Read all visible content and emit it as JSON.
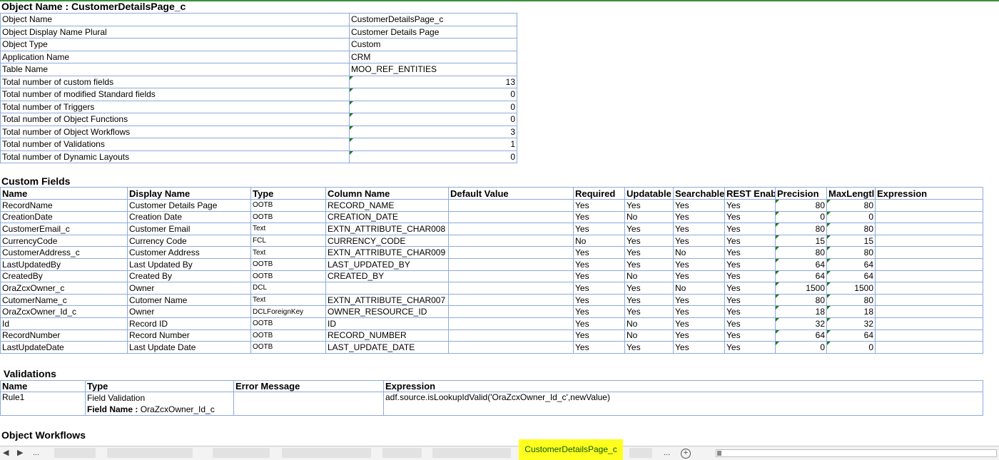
{
  "title": "Object Name : CustomerDetailsPage_c",
  "summary": [
    {
      "label": "Object Name",
      "value": "CustomerDetailsPage_c",
      "numeric": false
    },
    {
      "label": "Object Display Name Plural",
      "value": "Customer Details Page",
      "numeric": false
    },
    {
      "label": "Object Type",
      "value": "Custom",
      "numeric": false
    },
    {
      "label": "Application Name",
      "value": "CRM",
      "numeric": false
    },
    {
      "label": "Table Name",
      "value": "MOO_REF_ENTITIES",
      "numeric": false
    },
    {
      "label": "Total number of custom fields",
      "value": "13",
      "numeric": true
    },
    {
      "label": "Total number of modified Standard fields",
      "value": "0",
      "numeric": true
    },
    {
      "label": "Total number of Triggers",
      "value": "0",
      "numeric": true
    },
    {
      "label": "Total number of Object Functions",
      "value": "0",
      "numeric": true
    },
    {
      "label": "Total number of Object Workflows",
      "value": "3",
      "numeric": true
    },
    {
      "label": "Total number of Validations",
      "value": "1",
      "numeric": true
    },
    {
      "label": "Total number of Dynamic Layouts",
      "value": "0",
      "numeric": true
    }
  ],
  "custom_fields": {
    "heading": "Custom Fields",
    "columns": [
      "Name",
      "Display Name",
      "Type",
      "Column Name",
      "Default Value",
      "Required",
      "Updatable",
      "Searchable",
      "REST Enab",
      "Precision",
      "MaxLengtl",
      "Expression"
    ],
    "rows": [
      [
        "RecordName",
        "Customer Details Page",
        "OOTB",
        "RECORD_NAME",
        "",
        "Yes",
        "Yes",
        "Yes",
        "Yes",
        "80",
        "80",
        ""
      ],
      [
        "CreationDate",
        "Creation Date",
        "OOTB",
        "CREATION_DATE",
        "",
        "Yes",
        "No",
        "Yes",
        "Yes",
        "0",
        "0",
        ""
      ],
      [
        "CustomerEmail_c",
        "Customer Email",
        "Text",
        "EXTN_ATTRIBUTE_CHAR008",
        "",
        "Yes",
        "Yes",
        "Yes",
        "Yes",
        "80",
        "80",
        ""
      ],
      [
        "CurrencyCode",
        "Currency Code",
        "FCL",
        "CURRENCY_CODE",
        "",
        "No",
        "Yes",
        "Yes",
        "Yes",
        "15",
        "15",
        ""
      ],
      [
        "CustomerAddress_c",
        "Customer Address",
        "Text",
        "EXTN_ATTRIBUTE_CHAR009",
        "",
        "Yes",
        "Yes",
        "No",
        "Yes",
        "80",
        "80",
        ""
      ],
      [
        "LastUpdatedBy",
        "Last Updated By",
        "OOTB",
        "LAST_UPDATED_BY",
        "",
        "Yes",
        "Yes",
        "Yes",
        "Yes",
        "64",
        "64",
        ""
      ],
      [
        "CreatedBy",
        "Created By",
        "OOTB",
        "CREATED_BY",
        "",
        "Yes",
        "No",
        "Yes",
        "Yes",
        "64",
        "64",
        ""
      ],
      [
        "OraZcxOwner_c",
        "Owner",
        "DCL",
        "",
        "",
        "Yes",
        "Yes",
        "No",
        "Yes",
        "1500",
        "1500",
        ""
      ],
      [
        "CutomerName_c",
        "Cutomer Name",
        "Text",
        "EXTN_ATTRIBUTE_CHAR007",
        "",
        "Yes",
        "Yes",
        "Yes",
        "Yes",
        "80",
        "80",
        ""
      ],
      [
        "OraZcxOwner_Id_c",
        "Owner",
        "DCLForeignKey",
        "OWNER_RESOURCE_ID",
        "",
        "Yes",
        "Yes",
        "Yes",
        "Yes",
        "18",
        "18",
        ""
      ],
      [
        "Id",
        "Record ID",
        "OOTB",
        "ID",
        "",
        "Yes",
        "No",
        "Yes",
        "Yes",
        "32",
        "32",
        ""
      ],
      [
        "RecordNumber",
        "Record Number",
        "OOTB",
        "RECORD_NUMBER",
        "",
        "Yes",
        "No",
        "Yes",
        "Yes",
        "64",
        "64",
        ""
      ],
      [
        "LastUpdateDate",
        "Last Update Date",
        "OOTB",
        "LAST_UPDATE_DATE",
        "",
        "Yes",
        "Yes",
        "Yes",
        "Yes",
        "0",
        "0",
        ""
      ]
    ]
  },
  "validations": {
    "heading": "Validations",
    "columns": [
      "Name",
      "Type",
      "Error Message",
      "Expression"
    ],
    "rule": "Rule1",
    "type": "Field Validation",
    "field_label": "Field Name : ",
    "field_value": "OraZcxOwner_Id_c",
    "error_message": "",
    "expression": "adf.source.isLookupIdValid('OraZcxOwner_Id_c',newValue)"
  },
  "workflows_heading": "Object Workflows",
  "sheet_bar": {
    "ellipsis_left": "...",
    "active_sheet": "CustomerDetailsPage_c",
    "ellipsis_right": "...",
    "add_symbol": "+",
    "prev_arrow": "◀",
    "next_arrow": "▶"
  }
}
